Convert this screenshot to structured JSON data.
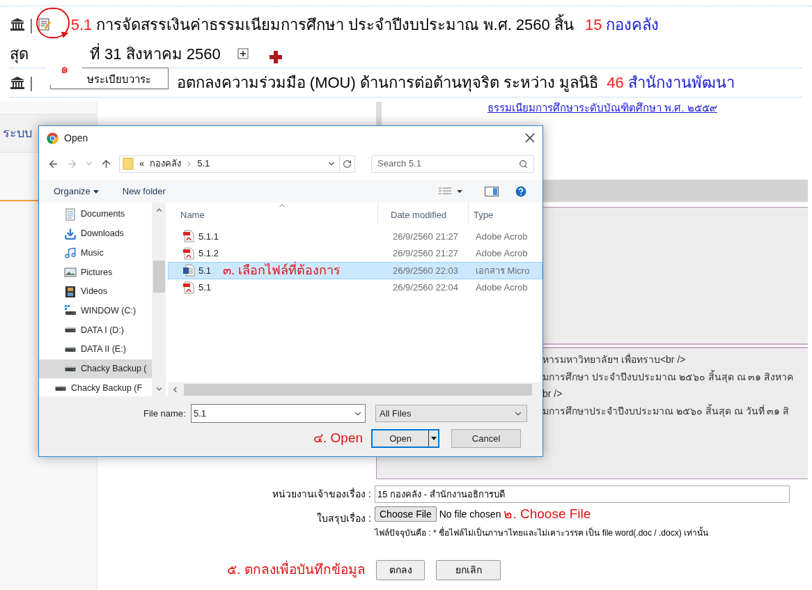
{
  "agenda_rows": [
    {
      "separator": "|",
      "number": "5.1",
      "title": "การจัดสรรเงินค่าธรรมเนียมการศึกษา ประจำปีงบประมาณ พ.ศ. 2560 สิ้น",
      "unit_code": "15",
      "unit": "กองคลัง",
      "continuation": [
        "สุด",
        "ที่ 31 สิงหาคม 2560"
      ]
    },
    {
      "separator": "|",
      "title": "อตกลงความร่วมมือ (MOU) ด้านการต่อต้านทุจริต ระหว่าง มูลนิธิ",
      "unit_code": "46",
      "unit": "สำนักงานพัฒนา"
    }
  ],
  "tooltip": "ษระเบียบวาระ",
  "step_1": "๑",
  "sidebar": {
    "title": "ระบบ"
  },
  "top_link": "ธรรมเนียมการศึกษาระดับบัณฑิตศึกษา พ.ศ. ๒๕๕๙",
  "summary_lines": [
    "หารมหาวิทยาลัยฯ เพื่อทราบ<br />",
    "มการศึกษา ประจำปีงบประมาณ ๒๕๖๐ สิ้นสุด ณ ๓๑ สิงหาค",
    "br />",
    "มการศึกษาประจำปีงบประมาณ ๒๕๖๐ สิ้นสุด ณ วันที่ ๓๑ สิ"
  ],
  "dialog": {
    "title": "Open",
    "path": [
      "«",
      "กองคลัง",
      "5.1"
    ],
    "search_placeholder": "Search 5.1",
    "toolbar": [
      "Organize",
      "New folder"
    ],
    "nav": [
      {
        "kind": "documents",
        "label": "Documents",
        "selected": false
      },
      {
        "kind": "downloads",
        "label": "Downloads",
        "selected": false
      },
      {
        "kind": "music",
        "label": "Music",
        "selected": false
      },
      {
        "kind": "pictures",
        "label": "Pictures",
        "selected": false
      },
      {
        "kind": "videos",
        "label": "Videos",
        "selected": false
      },
      {
        "kind": "system_drive",
        "label": "WINDOW (C:)",
        "selected": false
      },
      {
        "kind": "drive",
        "label": "DATA I (D:)",
        "selected": false
      },
      {
        "kind": "drive",
        "label": "DATA II (E:)",
        "selected": false
      },
      {
        "kind": "drive",
        "label": "Chacky Backup (",
        "selected": true
      },
      {
        "kind": "drive",
        "label": "Chacky Backup (F",
        "selected": false
      }
    ],
    "columns": [
      "Name",
      "Date modified",
      "Type"
    ],
    "files": [
      {
        "kind": "pdf",
        "name": "5.1.1",
        "date": "26/9/2560 21:27",
        "type": "Adobe Acrob",
        "selected": false
      },
      {
        "kind": "pdf",
        "name": "5.1.2",
        "date": "26/9/2560 21:27",
        "type": "Adobe Acrob",
        "selected": false
      },
      {
        "kind": "word",
        "name": "5.1",
        "date": "26/9/2560 22:03",
        "type": "เอกสาร Micro",
        "selected": true
      },
      {
        "kind": "pdf",
        "name": "5.1",
        "date": "26/9/2560 22:04",
        "type": "Adobe Acrob",
        "selected": false
      }
    ],
    "step_3": "๓. เลือกไฟล์ที่ต้องการ",
    "file_name_label": "File name:",
    "file_name": "5.1",
    "filter": "All Files",
    "step_4": "๔. Open",
    "open": "Open",
    "cancel": "Cancel"
  },
  "form": {
    "owner_label": "หน่วยงานเจ้าของเรื่อง :",
    "owner_value": "15 กองคลัง - สำนักงานอธิการบดี",
    "summary_label": "ใบสรุปเรื่อง :",
    "choose_file": "Choose File",
    "no_file": "No file chosen",
    "step_2": "๒. Choose File",
    "note": "ไฟล์ปัจจุบันคือ : * ชื่อไฟล์ไม่เป็นภาษาไทยและไม่เคาะวรรค เป็น file word(.doc / .docx) เท่านั้น",
    "step_5": "๕. ตกลงเพื่อบันทึกข้อมูล",
    "ok": "ตกลง",
    "cancel": "ยกเลิก"
  }
}
